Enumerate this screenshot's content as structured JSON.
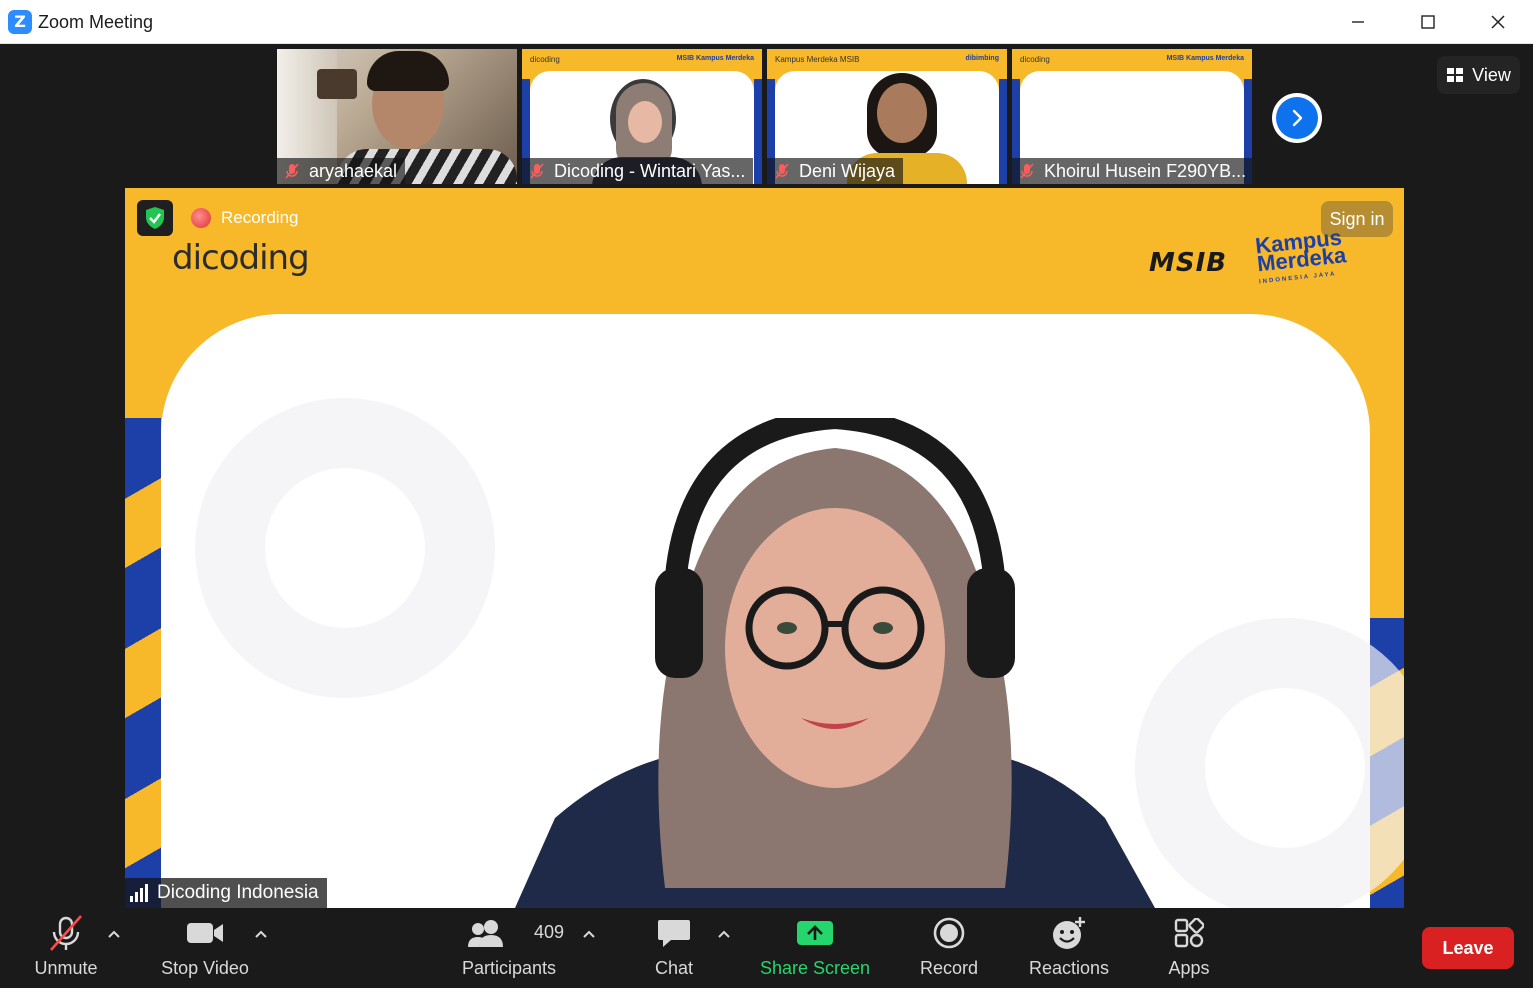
{
  "window": {
    "title": "Zoom Meeting",
    "app_icon_letter": "Z"
  },
  "thumbnails": [
    {
      "name": "aryahaekal",
      "muted": true,
      "kind": "camera"
    },
    {
      "name": "Dicoding - Wintari Yas...",
      "muted": true,
      "kind": "branded",
      "brand_left": "dicoding",
      "brand_right": "MSIB Kampus Merdeka"
    },
    {
      "name": "Deni Wijaya",
      "muted": true,
      "kind": "branded",
      "brand_left": "Kampus Merdeka MSIB",
      "brand_right": "dibimbing"
    },
    {
      "name": "Khoirul Husein F290YB...",
      "muted": true,
      "kind": "branded",
      "brand_left": "dicoding",
      "brand_right": "MSIB Kampus Merdeka"
    }
  ],
  "view_button": {
    "label": "View"
  },
  "main_video": {
    "recording_label": "Recording",
    "sign_in_label": "Sign in",
    "speaker_name": "Dicoding Indonesia",
    "logos": {
      "left": "dicoding",
      "msib": "MSIB",
      "kampus_line1": "Kampus",
      "kampus_line2": "Merdeka",
      "kampus_sub": "INDONESIA JAYA"
    }
  },
  "toolbar": {
    "unmute": "Unmute",
    "stop_video": "Stop Video",
    "participants": "Participants",
    "participant_count": "409",
    "chat": "Chat",
    "share_screen": "Share Screen",
    "record": "Record",
    "reactions": "Reactions",
    "apps": "Apps",
    "leave": "Leave"
  },
  "colors": {
    "accent": "#0e72ed",
    "share_green": "#24d66b",
    "leave_red": "#d92121",
    "brand_yellow": "#f7b92a",
    "brand_blue": "#1c3fa8"
  }
}
